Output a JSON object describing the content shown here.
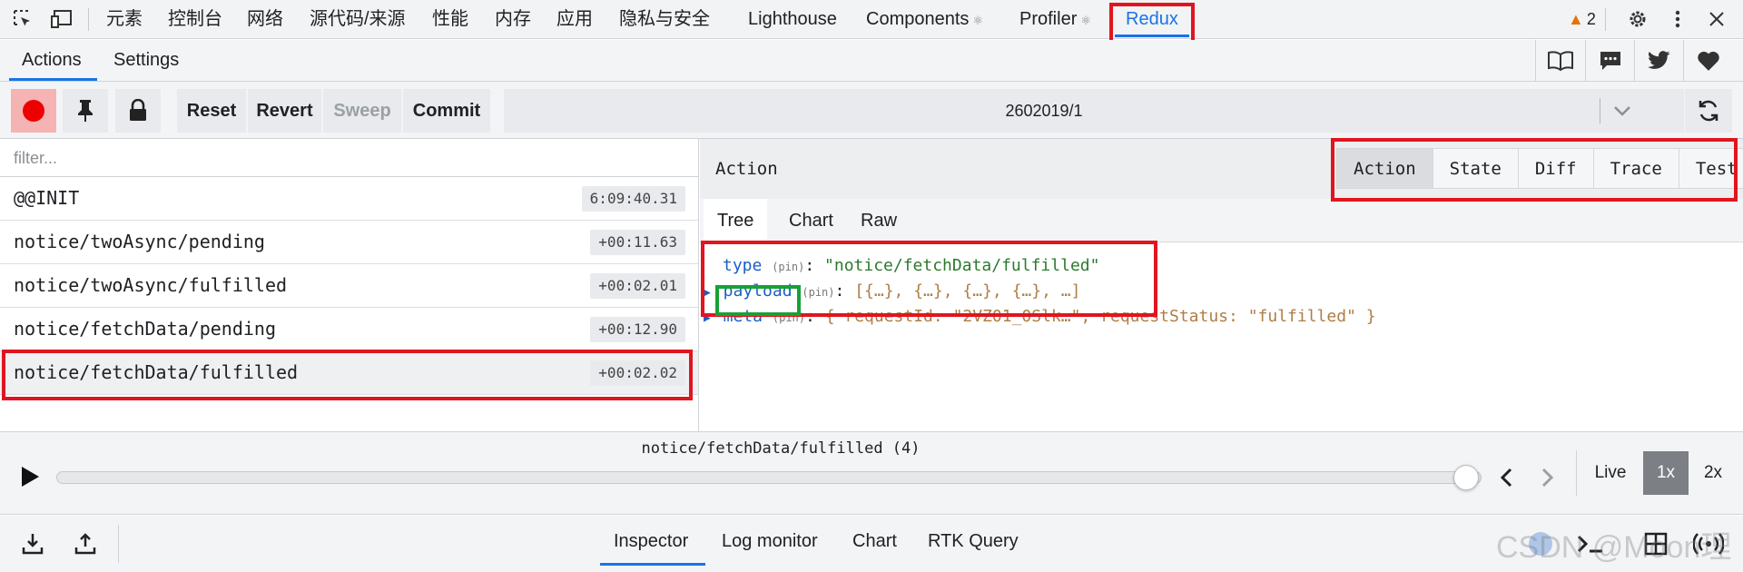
{
  "devtools_tabs": {
    "elements": "元素",
    "console": "控制台",
    "network": "网络",
    "sources": "源代码/来源",
    "performance": "性能",
    "memory": "内存",
    "application": "应用",
    "security": "隐私与安全",
    "lighthouse": "Lighthouse",
    "components": "Components",
    "profiler": "Profiler",
    "redux": "Redux",
    "warning_count": "2"
  },
  "panel_tabs": {
    "actions": "Actions",
    "settings": "Settings"
  },
  "toolbar": {
    "reset": "Reset",
    "revert": "Revert",
    "sweep": "Sweep",
    "commit": "Commit",
    "instance": "2602019/1"
  },
  "filter": {
    "placeholder": "filter..."
  },
  "actions": [
    {
      "name": "@@INIT",
      "time": "6:09:40.31"
    },
    {
      "name": "notice/twoAsync/pending",
      "time": "+00:11.63"
    },
    {
      "name": "notice/twoAsync/fulfilled",
      "time": "+00:02.01"
    },
    {
      "name": "notice/fetchData/pending",
      "time": "+00:12.90"
    },
    {
      "name": "notice/fetchData/fulfilled",
      "time": "+00:02.02"
    }
  ],
  "detail": {
    "title": "Action",
    "modes": [
      "Action",
      "State",
      "Diff",
      "Trace",
      "Test"
    ],
    "subtabs": [
      "Tree",
      "Chart",
      "Raw"
    ],
    "tree": {
      "type_key": "type",
      "pin": "(pin)",
      "type_value": "\"notice/fetchData/fulfilled\"",
      "payload_key": "payload",
      "payload_value": "[{…}, {…}, {…}, {…}, …]",
      "meta_key": "meta",
      "meta_value_prefix": "{ requestId: ",
      "meta_request_id": "\"2VZ01_0Slk…\"",
      "meta_mid": ", requestStatus: ",
      "meta_status": "\"fulfilled\"",
      "meta_suffix": " }"
    }
  },
  "slider": {
    "label": "notice/fetchData/fulfilled (4)",
    "position_fraction": 1.0,
    "live": "Live",
    "speed_1x": "1x",
    "speed_2x": "2x"
  },
  "bottom_tabs": {
    "inspector": "Inspector",
    "log_monitor": "Log monitor",
    "chart": "Chart",
    "rtk_query": "RTK Query"
  },
  "watermark": "CSDN @Moon理"
}
